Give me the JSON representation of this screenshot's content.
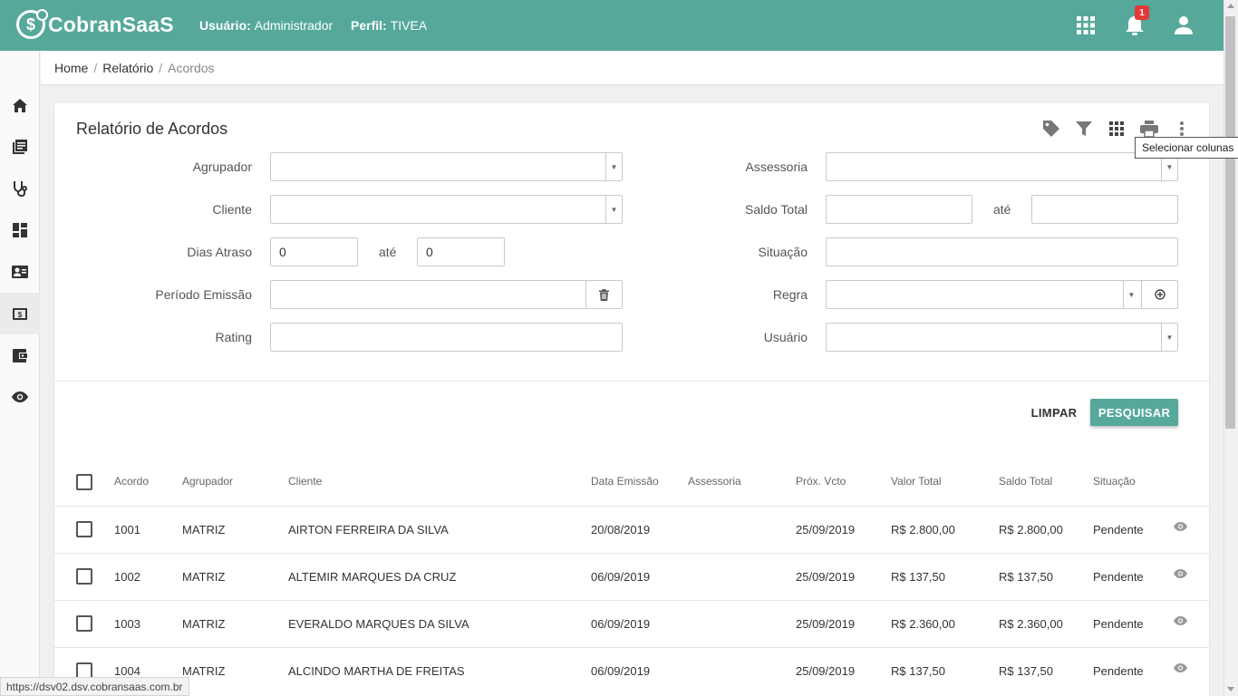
{
  "header": {
    "logo_text": "CobranSaaS",
    "logo_mark": "$",
    "user_label": "Usuário:",
    "user_value": "Administrador",
    "profile_label": "Perfil:",
    "profile_value": "TIVEA",
    "notification_count": "1",
    "icons": [
      "apps-grid-icon",
      "bell-icon",
      "user-account-icon"
    ],
    "brand_color": "#55a89a"
  },
  "sidebar": {
    "items": [
      "home-icon",
      "library-books-icon",
      "stethoscope-icon",
      "dashboard-icon",
      "contact-card-icon",
      "money-icon",
      "wallet-icon",
      "eye-icon"
    ],
    "active_index": 5
  },
  "breadcrumb": [
    "Home",
    "Relatório",
    "Acordos"
  ],
  "card": {
    "title": "Relatório de Acordos",
    "tools": [
      "tag-icon",
      "filter-icon",
      "columns-grid-icon",
      "print-icon",
      "more-vert-icon"
    ],
    "tooltip": "Selecionar colunas"
  },
  "form": {
    "agrupador_label": "Agrupador",
    "cliente_label": "Cliente",
    "dias_atraso_label": "Dias Atraso",
    "dias_atraso_from": "0",
    "dias_atraso_to": "0",
    "ate_label": "até",
    "periodo_emissao_label": "Período Emissão",
    "rating_label": "Rating",
    "assessoria_label": "Assessoria",
    "saldo_total_label": "Saldo Total",
    "situacao_label": "Situação",
    "regra_label": "Regra",
    "usuario_label": "Usuário"
  },
  "buttons": {
    "limpar": "LIMPAR",
    "pesquisar": "PESQUISAR"
  },
  "table": {
    "columns": [
      "Acordo",
      "Agrupador",
      "Cliente",
      "Data Emissão",
      "Assessoria",
      "Próx. Vcto",
      "Valor Total",
      "Saldo Total",
      "Situação"
    ],
    "rows": [
      {
        "acordo": "1001",
        "agrupador": "MATRIZ",
        "cliente": "AIRTON FERREIRA DA SILVA",
        "data_emissao": "20/08/2019",
        "assessoria": "",
        "prox_vcto": "25/09/2019",
        "valor_total": "R$ 2.800,00",
        "saldo_total": "R$ 2.800,00",
        "situacao": "Pendente"
      },
      {
        "acordo": "1002",
        "agrupador": "MATRIZ",
        "cliente": "ALTEMIR MARQUES DA CRUZ",
        "data_emissao": "06/09/2019",
        "assessoria": "",
        "prox_vcto": "25/09/2019",
        "valor_total": "R$ 137,50",
        "saldo_total": "R$ 137,50",
        "situacao": "Pendente"
      },
      {
        "acordo": "1003",
        "agrupador": "MATRIZ",
        "cliente": "EVERALDO MARQUES DA SILVA",
        "data_emissao": "06/09/2019",
        "assessoria": "",
        "prox_vcto": "25/09/2019",
        "valor_total": "R$ 2.360,00",
        "saldo_total": "R$ 2.360,00",
        "situacao": "Pendente"
      },
      {
        "acordo": "1004",
        "agrupador": "MATRIZ",
        "cliente": "ALCINDO MARTHA DE FREITAS",
        "data_emissao": "06/09/2019",
        "assessoria": "",
        "prox_vcto": "25/09/2019",
        "valor_total": "R$ 137,50",
        "saldo_total": "R$ 137,50",
        "situacao": "Pendente"
      }
    ]
  },
  "status_bar": {
    "url": "https://dsv02.dsv.cobransaas.com.br"
  }
}
